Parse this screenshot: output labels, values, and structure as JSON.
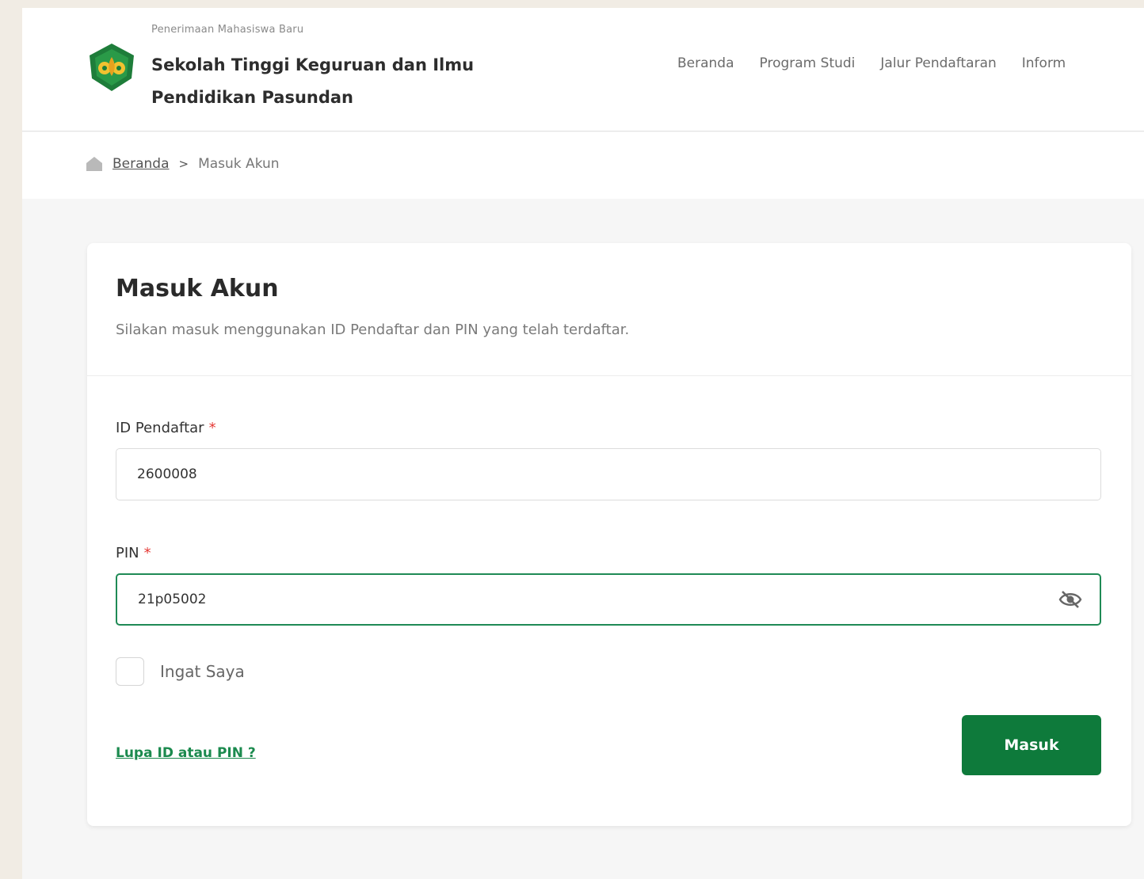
{
  "header": {
    "subtitle": "Penerimaan Mahasiswa Baru",
    "title": "Sekolah Tinggi Keguruan dan Ilmu Pendidikan Pasundan",
    "logo_icon": "campus-logo-icon",
    "nav": [
      {
        "label": "Beranda"
      },
      {
        "label": "Program Studi"
      },
      {
        "label": "Jalur Pendaftaran"
      },
      {
        "label": "Inform"
      }
    ]
  },
  "breadcrumb": {
    "home_icon": "home-icon",
    "home": "Beranda",
    "separator": ">",
    "current": "Masuk Akun"
  },
  "form": {
    "title": "Masuk Akun",
    "description": "Silakan masuk menggunakan ID Pendaftar dan PIN yang telah terdaftar.",
    "id_label": "ID Pendaftar",
    "id_value": "2600008",
    "pin_label": "PIN",
    "pin_value": "21p05002",
    "required_mark": "*",
    "toggle_icon": "eye-slash-icon",
    "remember_label": "Ingat Saya",
    "remember_checked": false,
    "forgot_link": "Lupa ID atau PIN ?",
    "submit_label": "Masuk"
  },
  "colors": {
    "primary": "#0e7a3b",
    "focus_border": "#1f8a55",
    "required": "#e53935",
    "background": "#f6f6f6"
  }
}
